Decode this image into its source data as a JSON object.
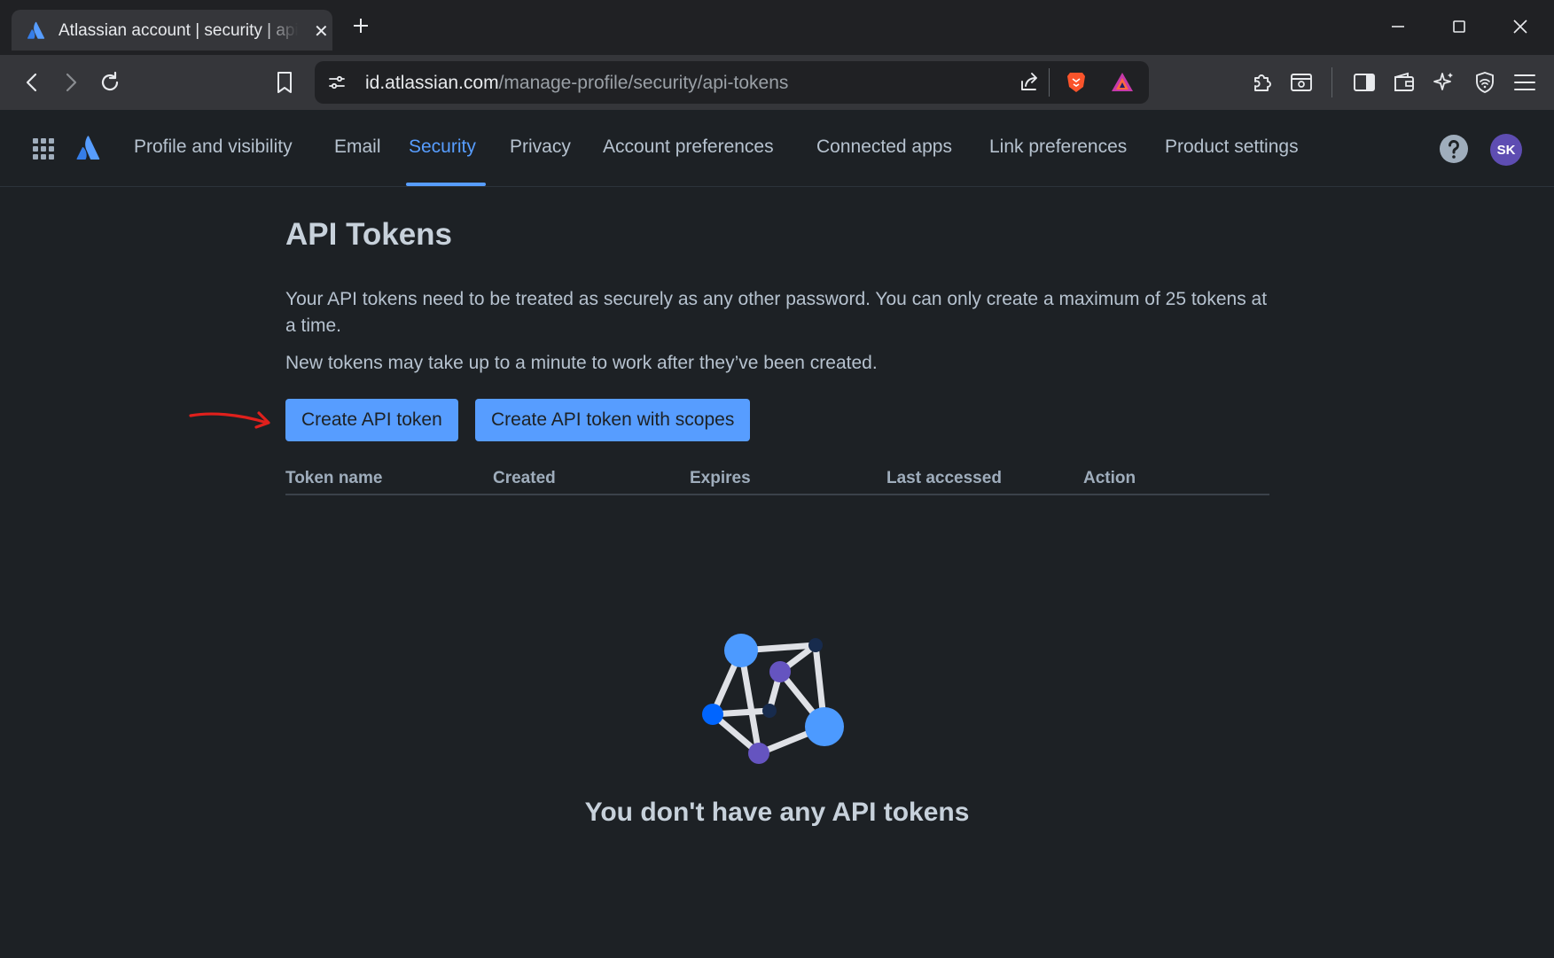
{
  "browser": {
    "tab": {
      "title": "Atlassian account | security | api tokens"
    },
    "url": {
      "host": "id.atlassian.com",
      "path": "/manage-profile/security/api-tokens"
    }
  },
  "nav": {
    "items": [
      {
        "label": "Profile and visibility"
      },
      {
        "label": "Email"
      },
      {
        "label": "Security",
        "active": true
      },
      {
        "label": "Privacy"
      },
      {
        "label": "Account preferences"
      },
      {
        "label": "Connected apps"
      },
      {
        "label": "Link preferences"
      },
      {
        "label": "Product settings"
      }
    ],
    "avatar_initials": "SK"
  },
  "main": {
    "title": "API Tokens",
    "description": "Your API tokens need to be treated as securely as any other password. You can only create a maximum of 25 tokens at a time.",
    "note": "New tokens may take up to a minute to work after they’ve been created.",
    "buttons": {
      "create": "Create API token",
      "create_scoped": "Create API token with scopes"
    },
    "table": {
      "columns": [
        "Token name",
        "Created",
        "Expires",
        "Last accessed",
        "Action"
      ]
    },
    "empty_state": "You don't have any API tokens"
  },
  "colors": {
    "background": "#1d2125",
    "accent": "#579dff",
    "avatar": "#5e4db2",
    "annotation_arrow": "#e0201c"
  }
}
